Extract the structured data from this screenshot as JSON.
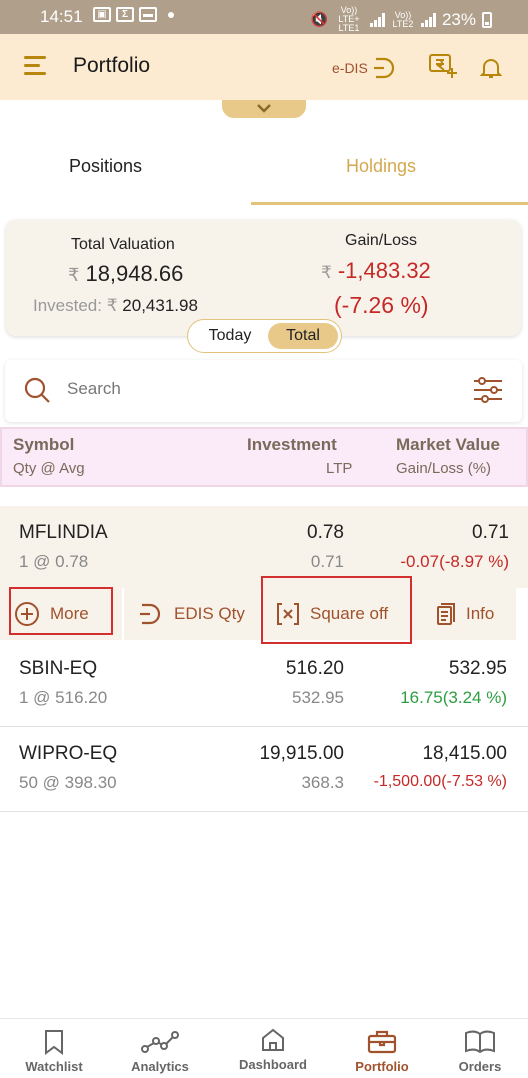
{
  "status_bar": {
    "time": "14:51",
    "battery": "23%",
    "net1": "Vo)) LTE+ LTE1",
    "net2": "Vo)) LTE2"
  },
  "app_bar": {
    "title": "Portfolio",
    "edis_label": "e-DIS"
  },
  "tabs": [
    {
      "label": "Positions",
      "active": false
    },
    {
      "label": "Holdings",
      "active": true
    }
  ],
  "summary": {
    "total_valuation_label": "Total Valuation",
    "currency_symbol": "₹",
    "total_valuation": "18,948.66",
    "invested_label": "Invested:",
    "invested_value": "20,431.98",
    "gain_loss_label": "Gain/Loss",
    "gain_loss_value": "-1,483.32",
    "gain_loss_pct": "(-7.26 %)"
  },
  "toggle": {
    "today": "Today",
    "total": "Total",
    "selected": "Total"
  },
  "search": {
    "placeholder": "Search"
  },
  "columns": {
    "symbol": "Symbol",
    "qty_avg": "Qty @ Avg",
    "investment": "Investment",
    "ltp": "LTP",
    "market_value": "Market Value",
    "gain_loss_pct": "Gain/Loss (%)"
  },
  "holdings": [
    {
      "symbol": "MFLINDIA",
      "qty_avg": "1 @ 0.78",
      "investment": "0.78",
      "ltp": "0.71",
      "market_value": "0.71",
      "gain_loss": "-0.07(-8.97 %)",
      "trend": "negative"
    },
    {
      "symbol": "SBIN-EQ",
      "qty_avg": "1 @ 516.20",
      "investment": "516.20",
      "ltp": "532.95",
      "market_value": "532.95",
      "gain_loss": "16.75(3.24 %)",
      "trend": "positive"
    },
    {
      "symbol": "WIPRO-EQ",
      "qty_avg": "50 @ 398.30",
      "investment": "19,915.00",
      "ltp": "368.3",
      "market_value": "18,415.00",
      "gain_loss": "-1,500.00(-7.53 %)",
      "trend": "negative"
    }
  ],
  "row_actions": {
    "more": "More",
    "edis_qty": "EDIS Qty",
    "square_off": "Square off",
    "info": "Info"
  },
  "bottom_nav": [
    {
      "label": "Watchlist",
      "icon": "bookmark-icon",
      "active": false
    },
    {
      "label": "Analytics",
      "icon": "analytics-icon",
      "active": false
    },
    {
      "label": "Dashboard",
      "icon": "home-icon",
      "active": false
    },
    {
      "label": "Portfolio",
      "icon": "briefcase-icon",
      "active": true
    },
    {
      "label": "Orders",
      "icon": "book-icon",
      "active": false
    }
  ],
  "colors": {
    "accent": "#a0522d",
    "gold": "#d4a94e",
    "negative": "#c62828",
    "positive": "#2e9d42",
    "highlight_box": "#d32f2f"
  }
}
